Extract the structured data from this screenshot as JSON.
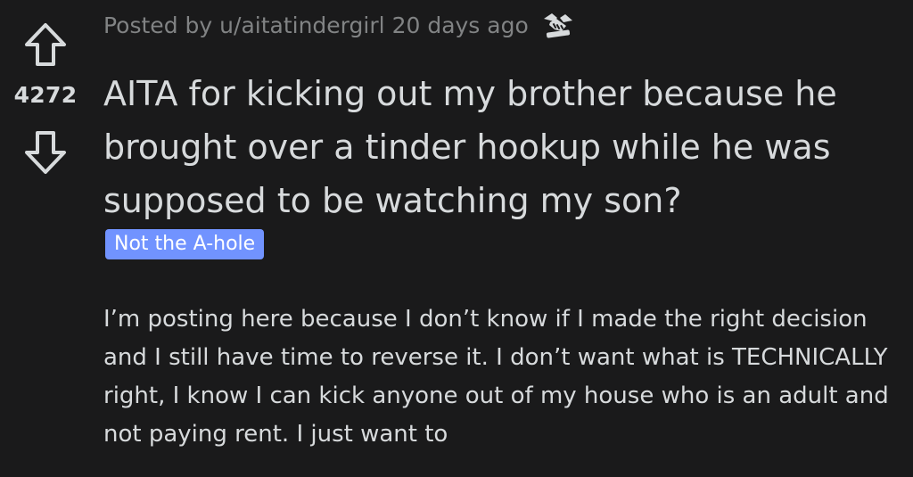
{
  "vote": {
    "score": "4272",
    "upvote_icon": "arrow-up-outline",
    "downvote_icon": "arrow-down-outline"
  },
  "post": {
    "meta_prefix": "Posted by",
    "username": "u/aitatindergirl",
    "time": "20 days ago",
    "award_icon": "handshake-award",
    "title": "AITA for kicking out my brother because he brought over a tinder hookup while he was supposed to be watching my son?",
    "flair": "Not the A-hole",
    "body": "I’m posting here because I don’t know if I made the right decision and I still have time to reverse it. I don’t want what is TECHNICALLY right, I know I can kick anyone out of my house who is an adult and not paying rent. I just want to"
  },
  "colors": {
    "background": "#1a1a1b",
    "text": "#d7dadc",
    "meta_text": "#818384",
    "flair_bg": "#7193ff"
  }
}
